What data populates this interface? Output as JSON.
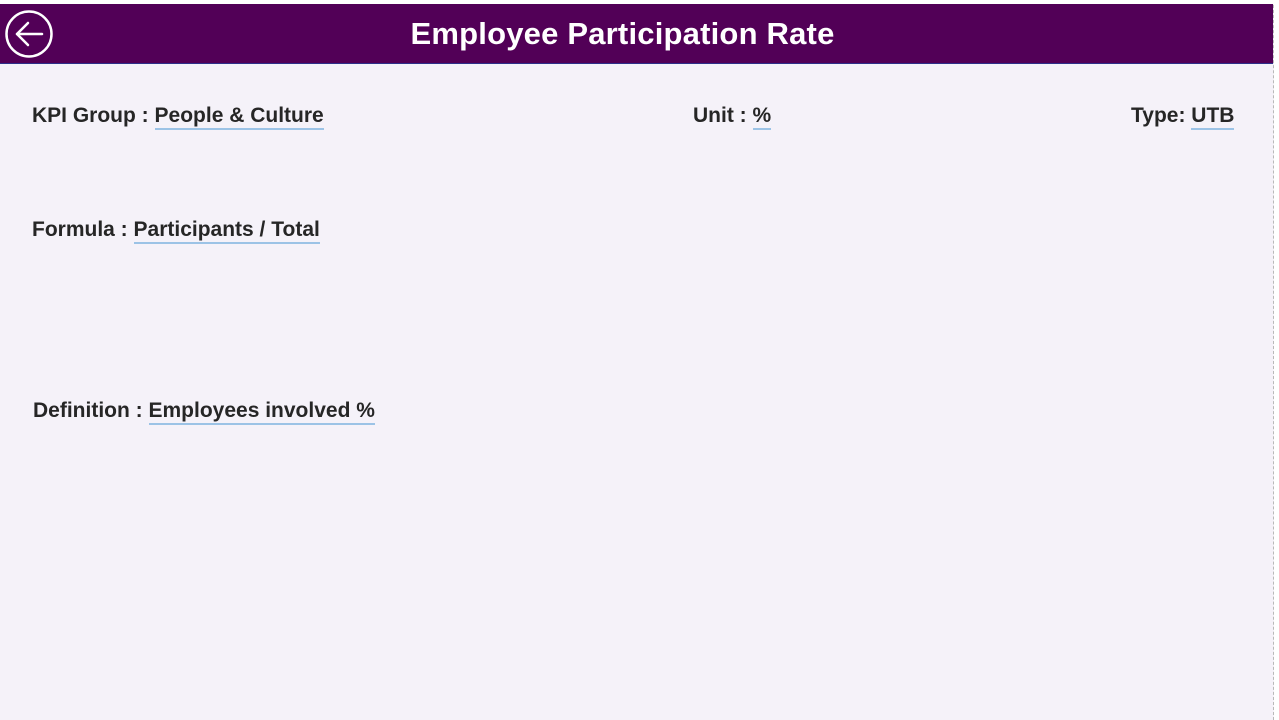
{
  "header": {
    "title": "Employee Participation Rate",
    "back_icon": "arrow-left-circle-icon",
    "background_color": "#520057",
    "text_color": "#ffffff"
  },
  "fields": {
    "kpi_group": {
      "label": "KPI Group :",
      "value": "People & Culture"
    },
    "unit": {
      "label": "Unit :",
      "value": "%"
    },
    "type": {
      "label": "Type:",
      "value": "UTB"
    },
    "formula": {
      "label": "Formula :",
      "value": "Participants / Total"
    },
    "definition": {
      "label": "Definition :",
      "value": "Employees involved %"
    }
  },
  "colors": {
    "page_background": "#f5f2f9",
    "value_underline": "#9cc3e6",
    "text": "#262626"
  }
}
